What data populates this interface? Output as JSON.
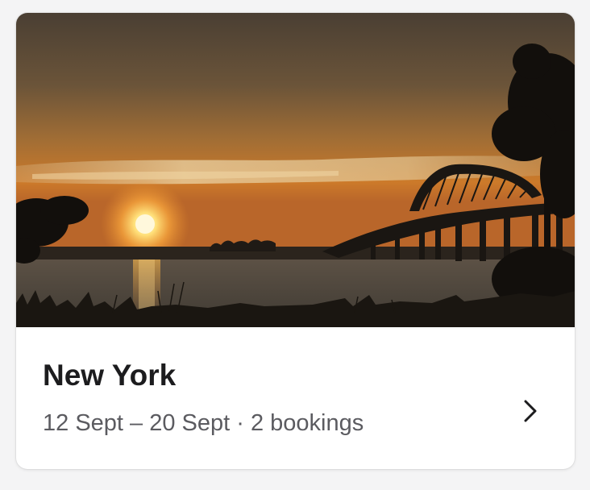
{
  "card": {
    "image_alt": "Sunset over a river with a steel arch bridge silhouette",
    "title": "New York",
    "dates": "12 Sept – 20 Sept",
    "separator": " · ",
    "bookings": "2 bookings",
    "chevron_icon": "chevron-right-icon"
  },
  "colors": {
    "title": "#1c1c1e",
    "subtitle": "#5b5b60",
    "card_bg": "#ffffff"
  }
}
